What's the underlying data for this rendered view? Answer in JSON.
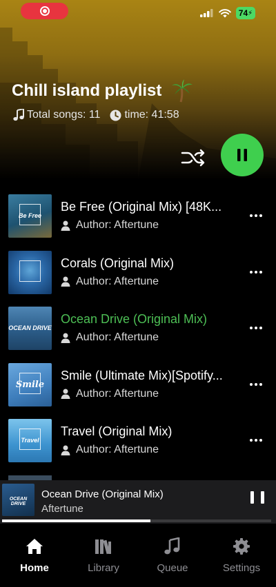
{
  "status": {
    "battery": "74"
  },
  "playlist": {
    "title": "Chill island playlist",
    "total_songs_label": "Total songs: 11",
    "time_label": "time: 41:58"
  },
  "tracks": [
    {
      "title": "Be Free (Original Mix) [48K...",
      "author": "Author: Aftertune",
      "cover_text": "Be Free",
      "cover_color": "#2b6a8a",
      "active": false
    },
    {
      "title": "Corals (Original Mix)",
      "author": "Author: Aftertune",
      "cover_text": "",
      "cover_color": "#1f4f86",
      "active": false
    },
    {
      "title": "Ocean Drive (Original Mix)",
      "author": "Author: Aftertune",
      "cover_text": "OCEAN DRIVE",
      "cover_color": "#3b6c98",
      "active": true
    },
    {
      "title": "Smile (Ultimate Mix)[Spotify...",
      "author": "Author: Aftertune",
      "cover_text": "Smile",
      "cover_color": "#4e8cc4",
      "active": false
    },
    {
      "title": "Travel (Original Mix)",
      "author": "Author: Aftertune",
      "cover_text": "Travel",
      "cover_color": "#4fa3d8",
      "active": false
    }
  ],
  "now_playing": {
    "title": "Ocean Drive (Original Mix)",
    "artist": "Aftertune",
    "cover_text": "OCEAN DRIVE",
    "progress": 0.55
  },
  "tabs": [
    {
      "label": "Home",
      "icon": "home-icon",
      "active": true
    },
    {
      "label": "Library",
      "icon": "library-icon",
      "active": false
    },
    {
      "label": "Queue",
      "icon": "music-note-icon",
      "active": false
    },
    {
      "label": "Settings",
      "icon": "gear-icon",
      "active": false
    }
  ],
  "colors": {
    "accent_green": "#3fcf4e",
    "active_track": "#4dbf55",
    "header_gold": "#a98414"
  }
}
